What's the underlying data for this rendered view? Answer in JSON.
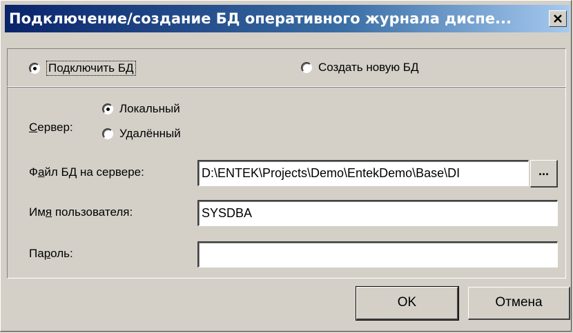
{
  "window": {
    "title": "Подключение/создание БД оперативного журнала диспе..."
  },
  "mode": {
    "connect_label": "Подключить БД",
    "connect_checked": true,
    "create_label": "Создать новую БД",
    "create_checked": false
  },
  "server": {
    "label": "Сервер:",
    "local_label": "Локальный",
    "local_checked": true,
    "remote_label": "Удалённый",
    "remote_checked": false
  },
  "db_file": {
    "label": "Файл БД на сервере:",
    "value": "D:\\ENTEK\\Projects\\Demo\\EntekDemo\\Base\\DI",
    "browse_label": "..."
  },
  "username": {
    "label": "Имя пользователя:",
    "value": "SYSDBA"
  },
  "password": {
    "label": "Пароль:",
    "value": ""
  },
  "buttons": {
    "ok": "OK",
    "cancel": "Отмена"
  },
  "icons": [
    "close-icon"
  ]
}
